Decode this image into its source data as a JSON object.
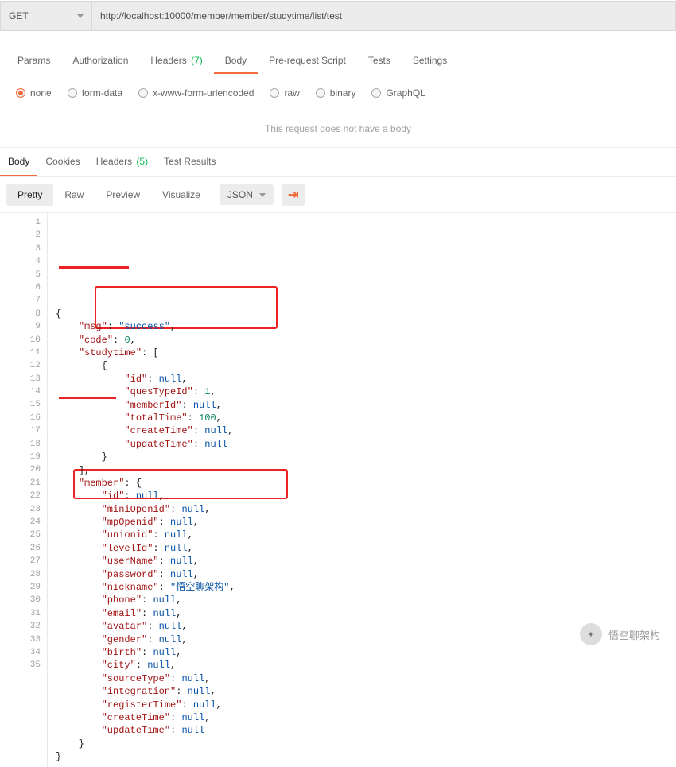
{
  "request": {
    "method": "GET",
    "url": "http://localhost:10000/member/member/studytime/list/test",
    "tabs": {
      "params": "Params",
      "authorization": "Authorization",
      "headers": "Headers",
      "headers_count": "(7)",
      "body": "Body",
      "prerequest": "Pre-request Script",
      "tests": "Tests",
      "settings": "Settings"
    },
    "body_types": {
      "none": "none",
      "formdata": "form-data",
      "xwww": "x-www-form-urlencoded",
      "raw": "raw",
      "binary": "binary",
      "graphql": "GraphQL"
    },
    "no_body_msg": "This request does not have a body"
  },
  "response": {
    "tabs": {
      "body": "Body",
      "cookies": "Cookies",
      "headers": "Headers",
      "headers_count": "(5)",
      "testresults": "Test Results"
    },
    "view_modes": {
      "pretty": "Pretty",
      "raw": "Raw",
      "preview": "Preview",
      "visualize": "Visualize"
    },
    "format_label": "JSON",
    "json": {
      "msg": "success",
      "code": 0,
      "studytime": [
        {
          "id": null,
          "quesTypeId": 1,
          "memberId": null,
          "totalTime": 100,
          "createTime": null,
          "updateTime": null
        }
      ],
      "member": {
        "id": null,
        "miniOpenid": null,
        "mpOpenid": null,
        "unionid": null,
        "levelId": null,
        "userName": null,
        "password": null,
        "nickname": "悟空聊架构",
        "phone": null,
        "email": null,
        "avatar": null,
        "gender": null,
        "birth": null,
        "city": null,
        "sourceType": null,
        "integration": null,
        "registerTime": null,
        "createTime": null,
        "updateTime": null
      }
    }
  },
  "watermark": {
    "text": "悟空聊架构"
  }
}
